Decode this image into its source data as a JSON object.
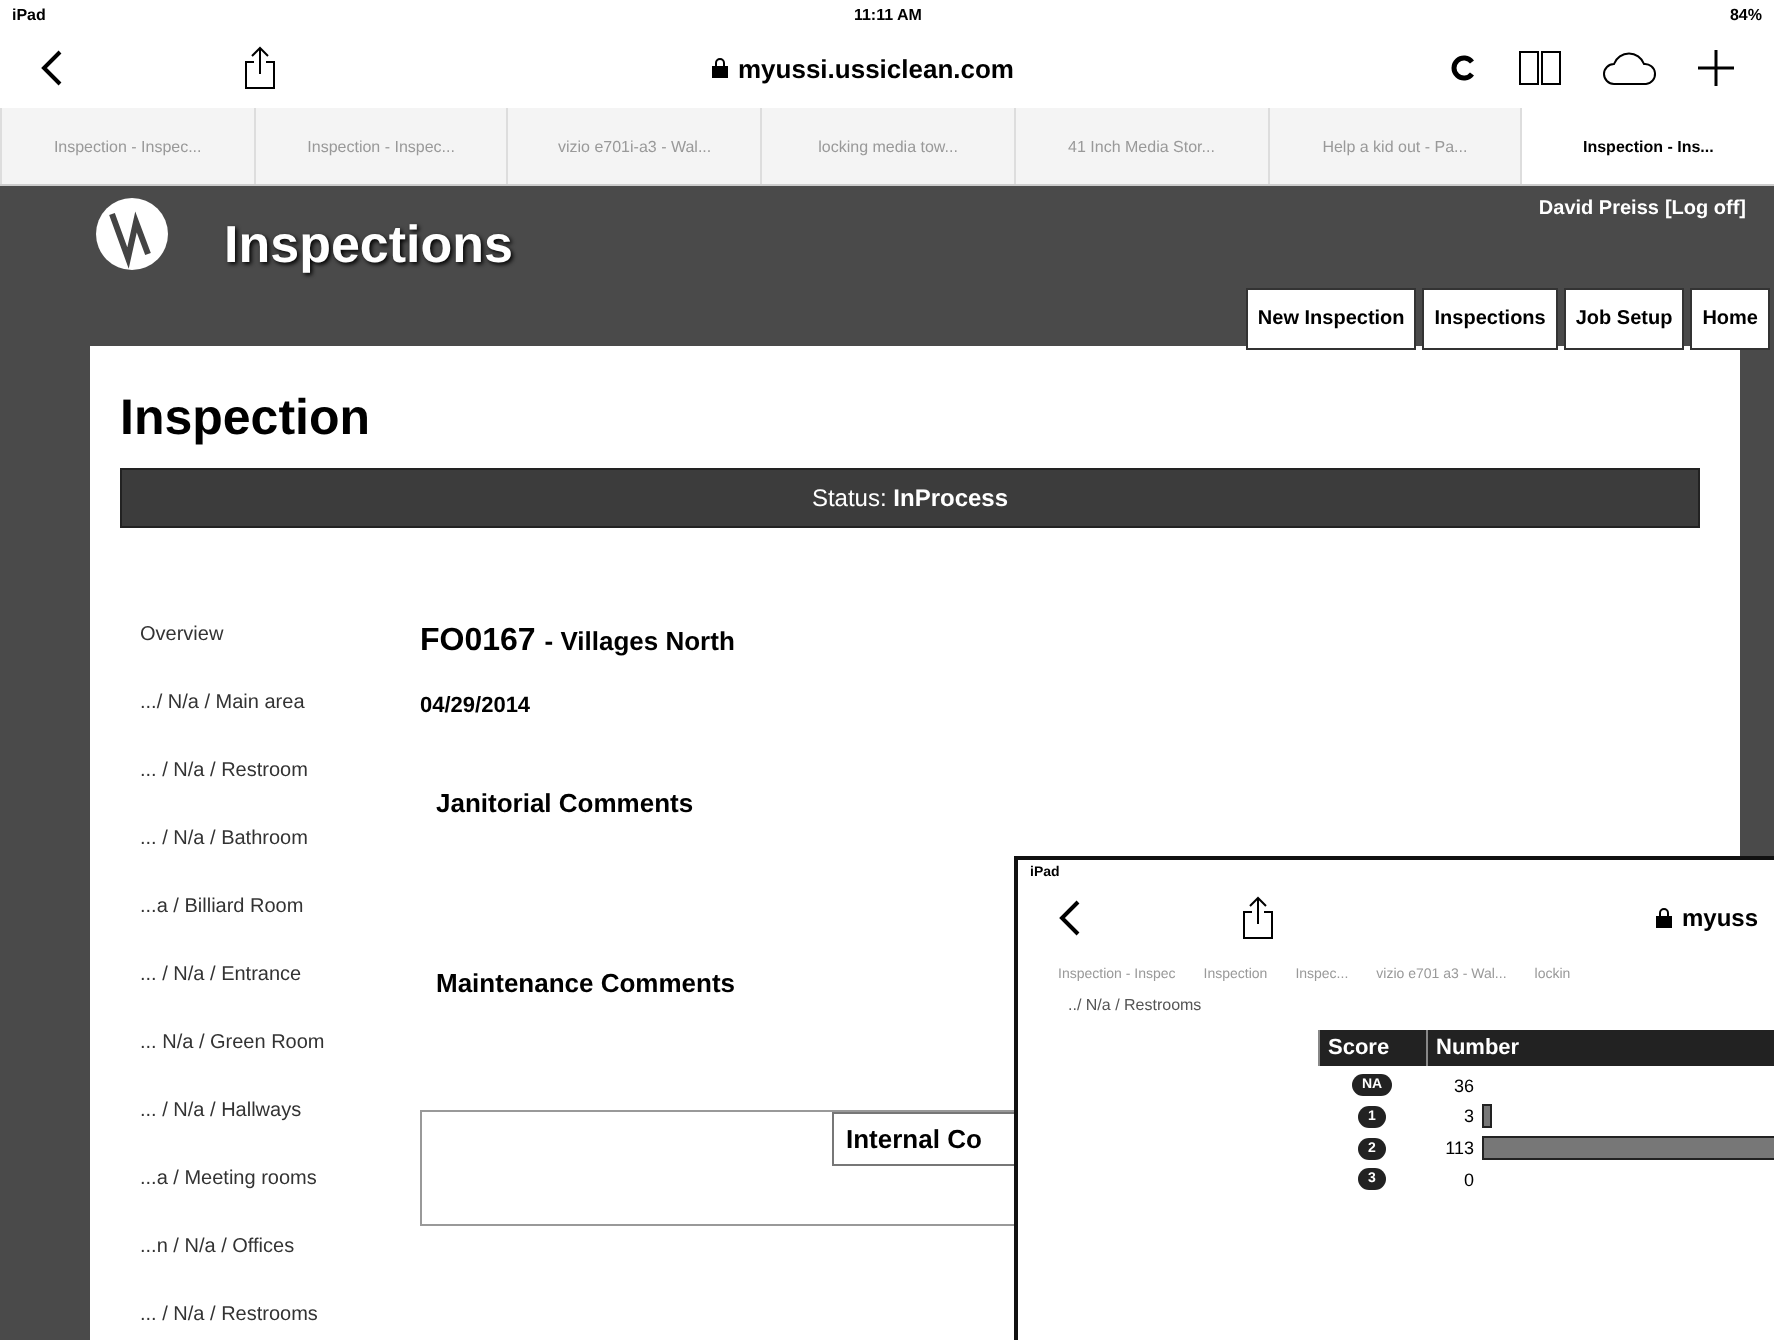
{
  "status_bar": {
    "device": "iPad",
    "time": "11:11 AM",
    "battery": "84%"
  },
  "browser": {
    "url": "myussi.ussiclean.com",
    "tabs": [
      {
        "label": "Inspection - Inspec...",
        "selected": false
      },
      {
        "label": "Inspection - Inspec...",
        "selected": false
      },
      {
        "label": "vizio e701i-a3 - Wal...",
        "selected": false
      },
      {
        "label": "locking media tow...",
        "selected": false
      },
      {
        "label": "41 Inch Media Stor...",
        "selected": false
      },
      {
        "label": "Help a kid out - Pa...",
        "selected": false
      },
      {
        "label": "Inspection - Ins...",
        "selected": true
      }
    ]
  },
  "site": {
    "title": "Inspections",
    "user": "David Preiss",
    "logoff": "[Log off]",
    "nav": [
      "New Inspection",
      "Inspections",
      "Job Setup",
      "Home"
    ]
  },
  "page": {
    "heading": "Inspection",
    "status_label": "Status:",
    "status_value": "InProcess",
    "sidebar": [
      "Overview",
      ".../ N/a / Main area",
      "... / N/a / Restroom",
      "... / N/a / Bathroom",
      "...a / Billiard Room",
      "... / N/a / Entrance",
      "... N/a / Green Room",
      "... / N/a / Hallways",
      "...a / Meeting rooms",
      "...n / N/a / Offices",
      "... / N/a / Restrooms"
    ],
    "job_code": "FO0167",
    "job_name": "- Villages North",
    "date": "04/29/2014",
    "sections": [
      "Janitorial Comments",
      "Maintenance Comments"
    ],
    "internal_label": "Internal Co"
  },
  "overlay": {
    "device": "iPad",
    "url": "myuss",
    "tabs": [
      "Inspection - Inspec",
      "Inspection",
      "Inspec...",
      "vizio e701 a3 - Wal...",
      "lockin"
    ],
    "sidebar_item": "../ N/a / Restrooms",
    "columns": [
      "Score",
      "Number"
    ],
    "rows": [
      {
        "score": "NA",
        "number": "36"
      },
      {
        "score": "1",
        "number": "3"
      },
      {
        "score": "2",
        "number": "113"
      },
      {
        "score": "3",
        "number": "0"
      }
    ]
  }
}
